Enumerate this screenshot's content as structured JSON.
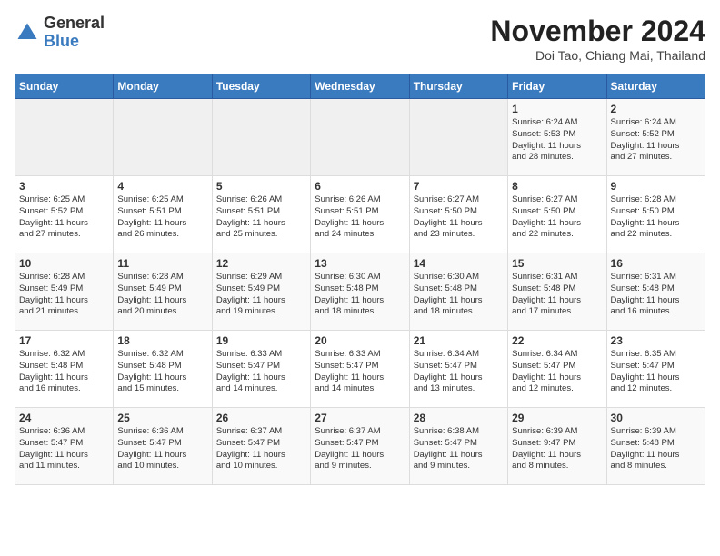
{
  "logo": {
    "text_general": "General",
    "text_blue": "Blue"
  },
  "header": {
    "title": "November 2024",
    "subtitle": "Doi Tao, Chiang Mai, Thailand"
  },
  "weekdays": [
    "Sunday",
    "Monday",
    "Tuesday",
    "Wednesday",
    "Thursday",
    "Friday",
    "Saturday"
  ],
  "weeks": [
    {
      "days": [
        {
          "num": "",
          "info": ""
        },
        {
          "num": "",
          "info": ""
        },
        {
          "num": "",
          "info": ""
        },
        {
          "num": "",
          "info": ""
        },
        {
          "num": "",
          "info": ""
        },
        {
          "num": "1",
          "info": "Sunrise: 6:24 AM\nSunset: 5:53 PM\nDaylight: 11 hours\nand 28 minutes."
        },
        {
          "num": "2",
          "info": "Sunrise: 6:24 AM\nSunset: 5:52 PM\nDaylight: 11 hours\nand 27 minutes."
        }
      ]
    },
    {
      "days": [
        {
          "num": "3",
          "info": "Sunrise: 6:25 AM\nSunset: 5:52 PM\nDaylight: 11 hours\nand 27 minutes."
        },
        {
          "num": "4",
          "info": "Sunrise: 6:25 AM\nSunset: 5:51 PM\nDaylight: 11 hours\nand 26 minutes."
        },
        {
          "num": "5",
          "info": "Sunrise: 6:26 AM\nSunset: 5:51 PM\nDaylight: 11 hours\nand 25 minutes."
        },
        {
          "num": "6",
          "info": "Sunrise: 6:26 AM\nSunset: 5:51 PM\nDaylight: 11 hours\nand 24 minutes."
        },
        {
          "num": "7",
          "info": "Sunrise: 6:27 AM\nSunset: 5:50 PM\nDaylight: 11 hours\nand 23 minutes."
        },
        {
          "num": "8",
          "info": "Sunrise: 6:27 AM\nSunset: 5:50 PM\nDaylight: 11 hours\nand 22 minutes."
        },
        {
          "num": "9",
          "info": "Sunrise: 6:28 AM\nSunset: 5:50 PM\nDaylight: 11 hours\nand 22 minutes."
        }
      ]
    },
    {
      "days": [
        {
          "num": "10",
          "info": "Sunrise: 6:28 AM\nSunset: 5:49 PM\nDaylight: 11 hours\nand 21 minutes."
        },
        {
          "num": "11",
          "info": "Sunrise: 6:28 AM\nSunset: 5:49 PM\nDaylight: 11 hours\nand 20 minutes."
        },
        {
          "num": "12",
          "info": "Sunrise: 6:29 AM\nSunset: 5:49 PM\nDaylight: 11 hours\nand 19 minutes."
        },
        {
          "num": "13",
          "info": "Sunrise: 6:30 AM\nSunset: 5:48 PM\nDaylight: 11 hours\nand 18 minutes."
        },
        {
          "num": "14",
          "info": "Sunrise: 6:30 AM\nSunset: 5:48 PM\nDaylight: 11 hours\nand 18 minutes."
        },
        {
          "num": "15",
          "info": "Sunrise: 6:31 AM\nSunset: 5:48 PM\nDaylight: 11 hours\nand 17 minutes."
        },
        {
          "num": "16",
          "info": "Sunrise: 6:31 AM\nSunset: 5:48 PM\nDaylight: 11 hours\nand 16 minutes."
        }
      ]
    },
    {
      "days": [
        {
          "num": "17",
          "info": "Sunrise: 6:32 AM\nSunset: 5:48 PM\nDaylight: 11 hours\nand 16 minutes."
        },
        {
          "num": "18",
          "info": "Sunrise: 6:32 AM\nSunset: 5:48 PM\nDaylight: 11 hours\nand 15 minutes."
        },
        {
          "num": "19",
          "info": "Sunrise: 6:33 AM\nSunset: 5:47 PM\nDaylight: 11 hours\nand 14 minutes."
        },
        {
          "num": "20",
          "info": "Sunrise: 6:33 AM\nSunset: 5:47 PM\nDaylight: 11 hours\nand 14 minutes."
        },
        {
          "num": "21",
          "info": "Sunrise: 6:34 AM\nSunset: 5:47 PM\nDaylight: 11 hours\nand 13 minutes."
        },
        {
          "num": "22",
          "info": "Sunrise: 6:34 AM\nSunset: 5:47 PM\nDaylight: 11 hours\nand 12 minutes."
        },
        {
          "num": "23",
          "info": "Sunrise: 6:35 AM\nSunset: 5:47 PM\nDaylight: 11 hours\nand 12 minutes."
        }
      ]
    },
    {
      "days": [
        {
          "num": "24",
          "info": "Sunrise: 6:36 AM\nSunset: 5:47 PM\nDaylight: 11 hours\nand 11 minutes."
        },
        {
          "num": "25",
          "info": "Sunrise: 6:36 AM\nSunset: 5:47 PM\nDaylight: 11 hours\nand 10 minutes."
        },
        {
          "num": "26",
          "info": "Sunrise: 6:37 AM\nSunset: 5:47 PM\nDaylight: 11 hours\nand 10 minutes."
        },
        {
          "num": "27",
          "info": "Sunrise: 6:37 AM\nSunset: 5:47 PM\nDaylight: 11 hours\nand 9 minutes."
        },
        {
          "num": "28",
          "info": "Sunrise: 6:38 AM\nSunset: 5:47 PM\nDaylight: 11 hours\nand 9 minutes."
        },
        {
          "num": "29",
          "info": "Sunrise: 6:39 AM\nSunset: 9:47 PM\nDaylight: 11 hours\nand 8 minutes."
        },
        {
          "num": "30",
          "info": "Sunrise: 6:39 AM\nSunset: 5:48 PM\nDaylight: 11 hours\nand 8 minutes."
        }
      ]
    }
  ]
}
